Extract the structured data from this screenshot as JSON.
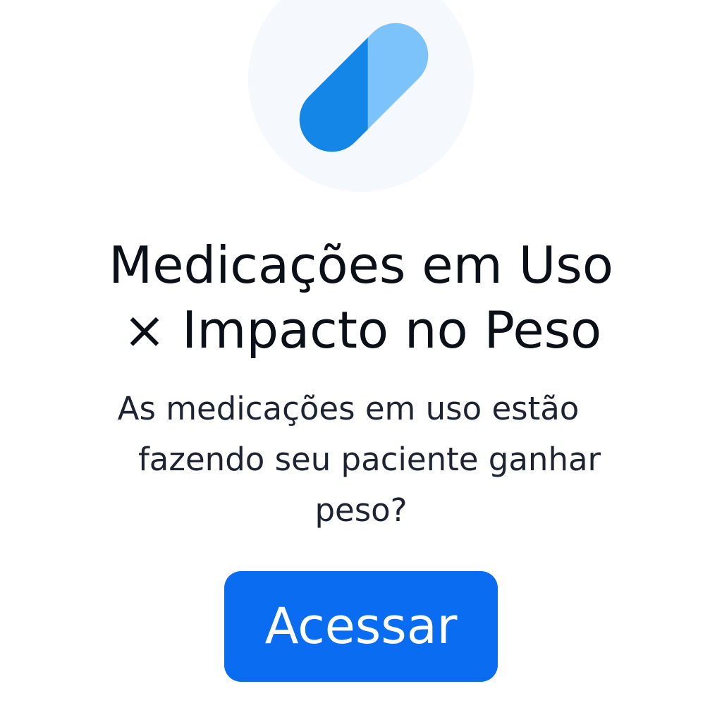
{
  "header": {
    "icon": "pill-icon",
    "title_line1": "Medicações em Uso",
    "title_line2": "× Impacto no Peso"
  },
  "body": {
    "description_line1": "As medicações em uso estão",
    "description_line2": "fazendo seu paciente ganhar",
    "description_line3": "peso?"
  },
  "cta": {
    "label": "Acessar"
  },
  "colors": {
    "pill_dark": "#1486e8",
    "pill_light": "#7cc3fb",
    "icon_bg": "#f5f8fc",
    "button_bg": "#0a6cf1",
    "title_text": "#0b0f17",
    "body_text": "#1d2331"
  }
}
